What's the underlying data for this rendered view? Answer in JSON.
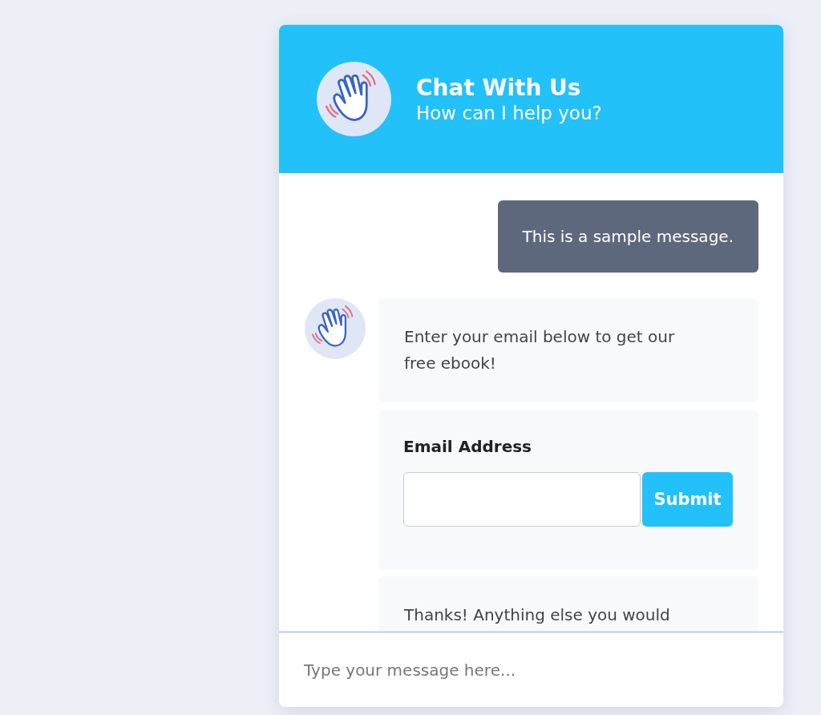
{
  "header": {
    "title": "Chat With Us",
    "subtitle": "How can I help you?"
  },
  "messages": [
    {
      "kind": "outgoing",
      "text": "This is a sample message."
    },
    {
      "kind": "incoming",
      "avatar": true,
      "text": "Enter your email below to get our free ebook!"
    },
    {
      "kind": "form",
      "label": "Email Address",
      "button": "Submit"
    },
    {
      "kind": "incoming",
      "avatar": false,
      "text": "Thanks! Anything else you would"
    }
  ],
  "composer": {
    "placeholder": "Type your message here..."
  }
}
